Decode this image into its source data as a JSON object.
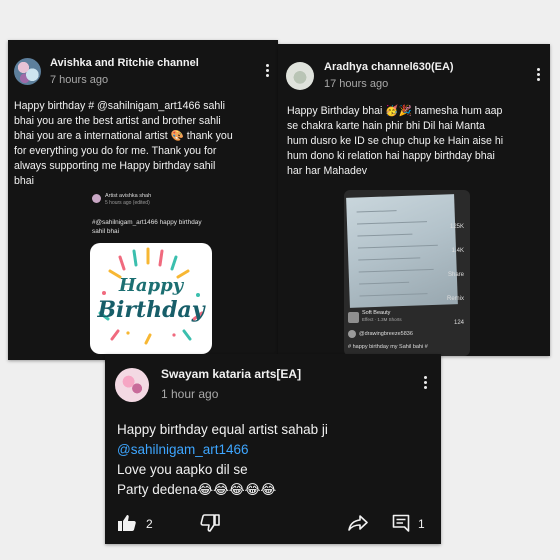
{
  "comments": [
    {
      "author": "Avishka and Ritchie channel",
      "time": "7 hours ago",
      "lines": [
        "Happy birthday # @sahilnigam_art1466  sahli",
        "bhai you are the best artist and brother sahli",
        "bhai you are a international artist 🎨 thank you",
        "for everything you do for me. Thank you for",
        "always supporting me Happy birthday sahil",
        "bhai"
      ],
      "embedded_comment": {
        "author": "Artist avishka shah",
        "time": "5 hours ago (edited)",
        "text": "#@sahilnigam_art1466  happy birthday sahil bhai"
      },
      "image_text": "Happy Birthday"
    },
    {
      "author": "Aradhya channel630(EA)",
      "time": "17 hours ago",
      "lines": [
        "Happy Birthday bhai  🥳🎉 hamesha hum aap",
        "se chakra karte hain phir bhi Dil hai Manta",
        "hum dusro ke ID se chup chup ke Hain aise hi",
        "hum dono ki relation hai happy birthday bhai",
        "har har Mahadev"
      ],
      "photo": {
        "sound_title": "Soft Beauty",
        "sound_sub": "Effect · 1.3M Shorts",
        "user": "@drawingbreeze5836",
        "caption": "# happy birthday my Sahil bahi #",
        "side_counts": [
          "125K",
          "1.4K",
          "Share",
          "Remix",
          "124"
        ]
      }
    },
    {
      "author": "Swayam kataria arts[EA]",
      "time": "1 hour ago",
      "line1": "Happy birthday equal artist sahab ji",
      "mention": "@sahilnigam_art1466",
      "line3": "Love you aapko dil se",
      "line4": "Party dedena😂😂😂😂😂",
      "likes": "2",
      "replies": "1"
    }
  ],
  "colors": {
    "card_bg": "#141414",
    "mention": "#3ea6ff",
    "page_bg": "#efefef"
  }
}
